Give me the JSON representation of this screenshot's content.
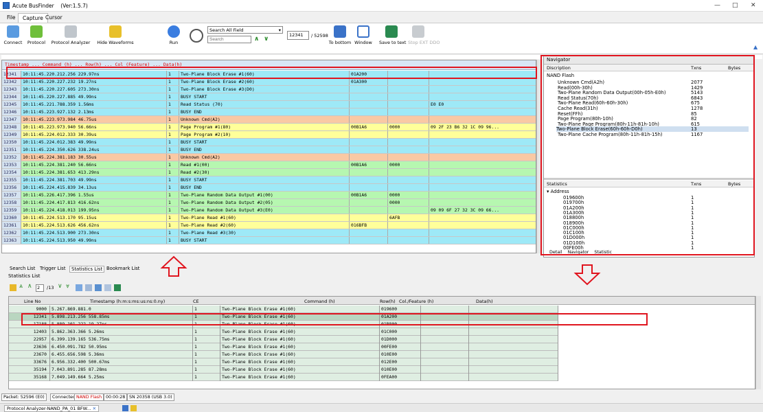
{
  "window": {
    "app": "Acute BusFinder",
    "version": "(Ver:1.5.7)",
    "min": "—",
    "max": "□",
    "close": "✕"
  },
  "menu_tabs": [
    "File",
    "Capture",
    "Cursor"
  ],
  "ribbon": {
    "connect": "Connect",
    "protocol": "Protocol",
    "protocol_analyzer": "Protocol Analyzer",
    "hide_waveforms": "Hide Waveforms",
    "run": "Run",
    "search_field": "Search All Field",
    "search_placeholder": "Search",
    "packet_index": "12341",
    "packet_total": "/ 52598",
    "to_bottom": "To bottom",
    "window": "Window",
    "save_to_text": "Save to text",
    "stop_ext": "Stop EXT DDO"
  },
  "colors": {
    "yellow": "#ffff9a",
    "cyan": "#9ee9f7",
    "green": "#b6f7b0",
    "orange": "#f9c9a4",
    "red_highlight": "#e0141e"
  },
  "grid": {
    "header": "Timestamp ... Command (h) ... Row(h) ... Col (Feature) ... Data(h)",
    "rows": [
      {
        "no": "12341",
        "ts": "10:11:45.220.212.256 229.97ns",
        "ce": "1",
        "cmd": "Two-Plane Block Erase #1(60)",
        "row": "01A200",
        "col": "",
        "data": "",
        "color": "cyan"
      },
      {
        "no": "12342",
        "ts": "10:11:45.220.227.232 19.27ns",
        "ce": "1",
        "cmd": " Two-Plane Block Erase #2(60)",
        "row": "01A300",
        "col": "",
        "data": "",
        "color": "cyan"
      },
      {
        "no": "12343",
        "ts": "10:11:45.220.227.605 273.30ns",
        "ce": "1",
        "cmd": "  Two-Plane Block Erase #3(D0)",
        "row": "",
        "col": "",
        "data": "",
        "color": "cyan"
      },
      {
        "no": "12344",
        "ts": "10:11:45.220.227.885 49.99ns",
        "ce": "1",
        "cmd": "   BUSY START",
        "row": "",
        "col": "",
        "data": "",
        "color": "cyan"
      },
      {
        "no": "12345",
        "ts": "10:11:45.221.788.359 1.56ms",
        "ce": "1",
        "cmd": "Read Status (70)",
        "row": "",
        "col": "",
        "data": "E0 E0",
        "color": "cyan"
      },
      {
        "no": "12346",
        "ts": "10:11:45.223.927.132 2.13ms",
        "ce": "1",
        "cmd": "   BUSY END",
        "row": "",
        "col": "",
        "data": "",
        "color": "cyan"
      },
      {
        "no": "12347",
        "ts": "10:11:45.223.973.984 46.75us",
        "ce": "1",
        "cmd": "Unknown Cmd(A2)",
        "row": "",
        "col": "",
        "data": "",
        "color": "orange"
      },
      {
        "no": "12348",
        "ts": "10:11:45.223.973.940 56.66ns",
        "ce": "1",
        "cmd": "Page Program #1(80)",
        "row": "00B1A6",
        "col": "0000",
        "data": "09 2F 23 B6 32 1C 09 96...",
        "color": "yellow"
      },
      {
        "no": "12349",
        "ts": "10:11:45.224.012.333 30.39us",
        "ce": "1",
        "cmd": " Page Program #2(10)",
        "row": "",
        "col": "",
        "data": "",
        "color": "yellow"
      },
      {
        "no": "12350",
        "ts": "10:11:45.224.012.383 49.99ns",
        "ce": "1",
        "cmd": "   BUSY START",
        "row": "",
        "col": "",
        "data": "",
        "color": "cyan"
      },
      {
        "no": "12351",
        "ts": "10:11:45.224.350.626 338.24us",
        "ce": "1",
        "cmd": "   BUSY END",
        "row": "",
        "col": "",
        "data": "",
        "color": "cyan"
      },
      {
        "no": "12352",
        "ts": "10:11:45.224.381.183 30.55us",
        "ce": "1",
        "cmd": "Unknown Cmd(A2)",
        "row": "",
        "col": "",
        "data": "",
        "color": "orange"
      },
      {
        "no": "12353",
        "ts": "10:11:45.224.381.240 56.66ns",
        "ce": "1",
        "cmd": "Read #1(00)",
        "row": "00B1A6",
        "col": "0000",
        "data": "",
        "color": "green"
      },
      {
        "no": "12354",
        "ts": "10:11:45.224.381.653 413.29ns",
        "ce": "1",
        "cmd": " Read #2(30)",
        "row": "",
        "col": "",
        "data": "",
        "color": "green"
      },
      {
        "no": "12355",
        "ts": "10:11:45.224.381.703 49.99ns",
        "ce": "1",
        "cmd": "   BUSY START",
        "row": "",
        "col": "",
        "data": "",
        "color": "cyan"
      },
      {
        "no": "12356",
        "ts": "10:11:45.224.415.839 34.13us",
        "ce": "1",
        "cmd": "   BUSY END",
        "row": "",
        "col": "",
        "data": "",
        "color": "cyan"
      },
      {
        "no": "12357",
        "ts": "10:11:45.226.417.396 1.55us",
        "ce": "1",
        "cmd": "Two-Plane Random Data Output #1(00)",
        "row": "00B1A6",
        "col": "0000",
        "data": "",
        "color": "green"
      },
      {
        "no": "12358",
        "ts": "10:11:45.224.417.813 416.62ns",
        "ce": "1",
        "cmd": " Two-Plane Random Data Output #2(05)",
        "row": "",
        "col": "0000",
        "data": "",
        "color": "green"
      },
      {
        "no": "12359",
        "ts": "10:11:45.224.418.013 199.95ns",
        "ce": "1",
        "cmd": " Two-Plane Random Data Output #3(E0)",
        "row": "",
        "col": "",
        "data": "09 09 6F 27 32 3C 09 66...",
        "color": "green"
      },
      {
        "no": "12360",
        "ts": "10:11:45.224.513.170 95.15us",
        "ce": "1",
        "cmd": "Two-Plane Read #1(60)",
        "row": "",
        "col": "6AFB",
        "data": "",
        "color": "yellow"
      },
      {
        "no": "12361",
        "ts": "10:11:45.224.513.626 456.62ns",
        "ce": "1",
        "cmd": " Two-Plane Read #2(60)",
        "row": "016BFB",
        "col": "",
        "data": "",
        "color": "yellow"
      },
      {
        "no": "12362",
        "ts": "10:11:45.224.513.900 273.30ns",
        "ce": "1",
        "cmd": " Two-Plane Read #3(30)",
        "row": "",
        "col": "",
        "data": "",
        "color": "cyan"
      },
      {
        "no": "12363",
        "ts": "10:11:45.224.513.950 49.99ns",
        "ce": "1",
        "cmd": "   BUSY START",
        "row": "",
        "col": "",
        "data": "",
        "color": "cyan"
      }
    ]
  },
  "navigator": {
    "title": "Navigator",
    "cols": {
      "desc": "Discription",
      "txns": "Txns",
      "bytes": "Bytes"
    },
    "root": "NAND Flash",
    "items": [
      {
        "name": "Unknown Cmd(A2h)",
        "txns": "2077"
      },
      {
        "name": "Read(00h-30h)",
        "txns": "1429"
      },
      {
        "name": "Two-Plane Random Data Output(00h-05h-E0h)",
        "txns": "5143"
      },
      {
        "name": "Read Status(70h)",
        "txns": "6843"
      },
      {
        "name": "Two-Plane Read(60h-60h-30h)",
        "txns": "675"
      },
      {
        "name": "Cache Read(31h)",
        "txns": "1278"
      },
      {
        "name": "Reset(FFh)",
        "txns": "85"
      },
      {
        "name": "Page Program(80h-10h)",
        "txns": "82"
      },
      {
        "name": "Two-Plane Page Program(80h-11h-81h-10h)",
        "txns": "615"
      },
      {
        "name": "Two-Plane Block Erase(60h-60h-D0h)",
        "txns": "13"
      },
      {
        "name": "Two-Plane Cache Program(80h-11h-81h-15h)",
        "txns": "1167"
      }
    ],
    "stats_title": "Statistics",
    "stats_root": "Address",
    "addresses": [
      {
        "name": "019600h",
        "txns": "1"
      },
      {
        "name": "019700h",
        "txns": "1"
      },
      {
        "name": "01A200h",
        "txns": "1"
      },
      {
        "name": "01A300h",
        "txns": "1"
      },
      {
        "name": "018800h",
        "txns": "1"
      },
      {
        "name": "018900h",
        "txns": "1"
      },
      {
        "name": "01C000h",
        "txns": "1"
      },
      {
        "name": "01C100h",
        "txns": "1"
      },
      {
        "name": "01D000h",
        "txns": "1"
      },
      {
        "name": "01D100h",
        "txns": "1"
      },
      {
        "name": "00FE00h",
        "txns": "1"
      }
    ],
    "tabs": [
      "Detail",
      "Navigator",
      "Statistic"
    ]
  },
  "bottom_tabs": [
    "Search List",
    "Trigger List",
    "Statistics List",
    "Bookmark List"
  ],
  "stat_list": {
    "title": "Statistics List",
    "page": "2",
    "page_total": "/13",
    "cols": {
      "no": "Line No",
      "ts": "Timestamp (h:m:s:ms:us:ns:0.ny)",
      "ce": "CE",
      "cmd": "Command (h)",
      "row": "Row(h)",
      "col": "Col./Feature (h)",
      "data": "Data(h)"
    },
    "rows": [
      {
        "no": "9000",
        "ts": "5.267.869.881.0",
        "ce": "1",
        "cmd": "Two-Plane Block Erase #1(60)",
        "row": "019600"
      },
      {
        "no": "12341",
        "ts": "5.898.213.256 558.85ms",
        "ce": "1",
        "cmd": "Two-Plane Block Erase #1(60)",
        "row": "01A200"
      },
      {
        "no": "17188",
        "ts": "5.889.101.222 19.27ns",
        "ce": "1",
        "cmd": "Two-Plane Block Erase #1(60)",
        "row": "01B800"
      },
      {
        "no": "12403",
        "ts": "5.862.363.366 5.26ms",
        "ce": "1",
        "cmd": "Two-Plane Block Erase #1(60)",
        "row": "01C000"
      },
      {
        "no": "22957",
        "ts": "6.399.139.165 536.75ms",
        "ce": "1",
        "cmd": "Two-Plane Block Erase #1(60)",
        "row": "01D000"
      },
      {
        "no": "23636",
        "ts": "6.450.091.782 50.95ms",
        "ce": "1",
        "cmd": "Two-Plane Block Erase #1(60)",
        "row": "00FE00"
      },
      {
        "no": "23670",
        "ts": "6.455.656.598 5.36ms",
        "ce": "1",
        "cmd": "Two-Plane Block Erase #1(60)",
        "row": "010E00"
      },
      {
        "no": "33676",
        "ts": "6.956.332.400 500.67ms",
        "ce": "1",
        "cmd": "Two-Plane Block Erase #1(60)",
        "row": "012E00"
      },
      {
        "no": "35194",
        "ts": "7.043.891.285 87.28ms",
        "ce": "1",
        "cmd": "Two-Plane Block Erase #1(60)",
        "row": "010E00"
      },
      {
        "no": "35168",
        "ts": "7.049.149.664 5.25ms",
        "ce": "1",
        "cmd": "Two-Plane Block Erase #1(60)",
        "row": "0FEA00"
      }
    ]
  },
  "status": {
    "packet": "Packet: 52596 (E0)",
    "connected": "Connected",
    "nand": "NAND Flash",
    "time": "00:00:28",
    "sn": "SN 20358 (USB 3.0)"
  },
  "taskbar": {
    "tab": "Protocol Analyzer-NAND_PA_01 BFW..."
  }
}
